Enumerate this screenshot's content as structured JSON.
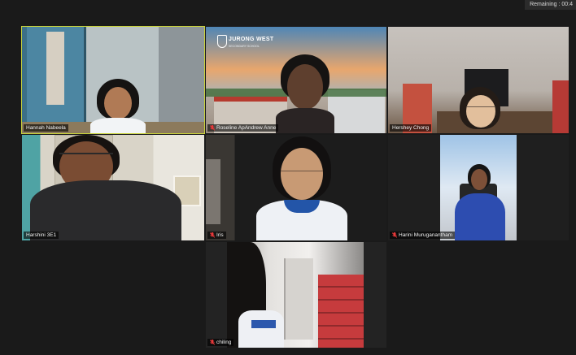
{
  "meeting": {
    "remaining_label": "Remaining : 00:4"
  },
  "participants": [
    {
      "name": "Hannah Nabeela",
      "muted": false,
      "active_speaker": true
    },
    {
      "name": "Roseline ApAndrew Anne",
      "muted": true,
      "active_speaker": false
    },
    {
      "name": "Hershey Chong",
      "muted": false,
      "active_speaker": false
    },
    {
      "name": "Harshini 3E1",
      "muted": false,
      "active_speaker": false
    },
    {
      "name": "Iris",
      "muted": true,
      "active_speaker": false
    },
    {
      "name": "Harini Muruganantham",
      "muted": true,
      "active_speaker": false
    },
    {
      "name": "chiling",
      "muted": true,
      "active_speaker": false
    }
  ],
  "background_branding": {
    "school_name": "JURONG WEST",
    "school_sub": "SECONDARY SCHOOL"
  },
  "colors": {
    "active_speaker_outline": "#c9d33a",
    "muted_icon": "#e8393a",
    "window_background": "#1a1a1a"
  },
  "icons": {
    "muted": "mic-muted-icon"
  }
}
